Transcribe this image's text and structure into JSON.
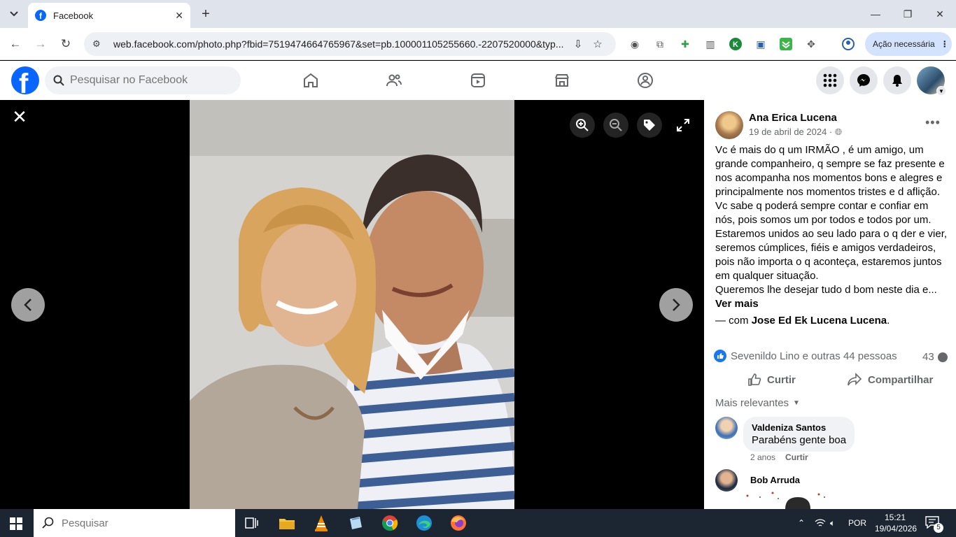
{
  "browser": {
    "tab_title": "Facebook",
    "url": "web.facebook.com/photo.php?fbid=7519474664765967&set=pb.100001105255660.-2207520000&typ...",
    "action_button": "Ação necessária"
  },
  "fb_header": {
    "search_placeholder": "Pesquisar no Facebook"
  },
  "post": {
    "author": "Ana Erica Lucena",
    "date": "19 de abril de 2024 · ",
    "text": "Vc é mais do q um IRMÃO , é um amigo, um grande companheiro, q sempre se faz presente e nos acompanha nos momentos bons e alegres e principalmente nos momentos tristes e d aflição. Vc sabe q poderá sempre contar e confiar em nós, pois somos um por todos e todos por um. Estaremos unidos ao seu lado para o q der e vier, seremos cúmplices, fiéis e amigos verdadeiros, pois não importa o q aconteça, estaremos juntos em qualquer situação.",
    "text2": "Queremos lhe desejar tudo d bom neste dia e...",
    "see_more": "Ver mais",
    "with_prefix": "— com ",
    "with_name": "Jose Ed Ek Lucena Lucena",
    "with_suffix": ".",
    "reactions": "Sevenildo Lino e outras 44 pessoas",
    "comment_count": "43",
    "like_label": "Curtir",
    "share_label": "Compartilhar",
    "filter_label": "Mais relevantes"
  },
  "comments": [
    {
      "name": "Valdeniza Santos",
      "text": "Parabéns gente boa",
      "time": "2 anos",
      "like": "Curtir"
    },
    {
      "name": "Bob Arruda"
    }
  ],
  "taskbar": {
    "search_placeholder": "Pesquisar",
    "lang": "POR",
    "time": "15:21",
    "date": "19/04/2026",
    "notifications": "5"
  },
  "colors": {
    "fb_blue": "#0866ff",
    "like_blue": "#1877f2",
    "taskbar": "#1c2532"
  }
}
